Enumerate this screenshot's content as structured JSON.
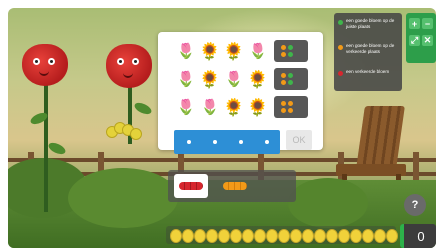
{
  "colors": {
    "correct_right_place": "#3fb54b",
    "correct_wrong_place": "#f29a18",
    "wrong_flower": "#d6262e",
    "answer_bar": "#2d8fd6",
    "zoom_panel": "#2d9e4a"
  },
  "legend": {
    "items": [
      {
        "text": "een goede bloem op de juiste plaats"
      },
      {
        "text": "een goede bloem op de verkeerde plaats"
      },
      {
        "text": "een verkeerde bloem"
      }
    ]
  },
  "puzzle": {
    "rows": [
      {
        "flowers": [
          "tulip",
          "sunflower",
          "sunflower",
          "tulip"
        ],
        "clue": [
          "orange",
          "green",
          "orange",
          "green"
        ]
      },
      {
        "flowers": [
          "tulip",
          "sunflower",
          "tulip",
          "sunflower"
        ],
        "clue": [
          "orange",
          "green",
          "orange",
          "green"
        ]
      },
      {
        "flowers": [
          "tulip",
          "tulip",
          "sunflower",
          "sunflower"
        ],
        "clue": [
          "orange",
          "orange",
          "orange",
          "orange"
        ]
      }
    ],
    "ok_label": "OK"
  },
  "flower_glyphs": {
    "tulip": "🌷",
    "sunflower": "🌻"
  },
  "zoom": {
    "plus": "+",
    "minus": "−",
    "expand": "⤢",
    "close": "✕"
  },
  "palette": {
    "options": [
      "red-tulips",
      "orange-sunflowers"
    ],
    "selected": "red-tulips"
  },
  "help_label": "?",
  "coins": {
    "count": 19
  },
  "score": "0"
}
